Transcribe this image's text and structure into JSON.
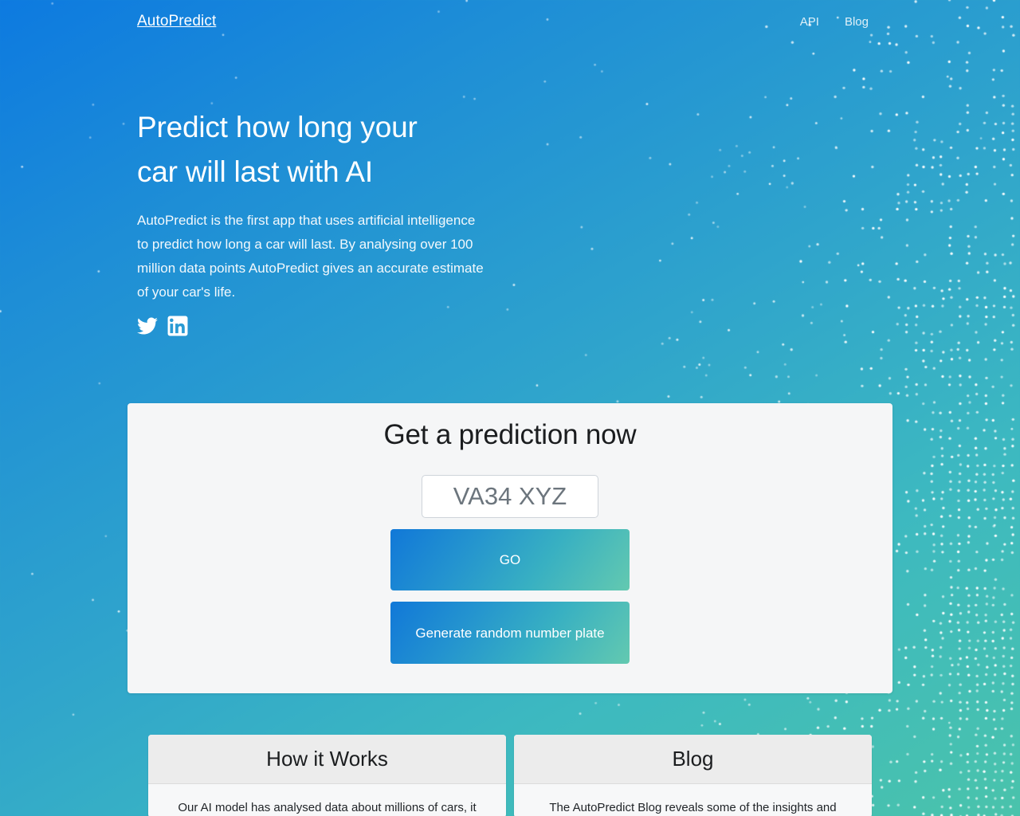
{
  "navbar": {
    "brand": "AutoPredict",
    "links": [
      {
        "label": "API"
      },
      {
        "label": "Blog"
      }
    ]
  },
  "hero": {
    "title_line1": "Predict how long your",
    "title_line2": "car will last with AI",
    "subtitle": "AutoPredict is the first app that uses artificial intelligence to predict how long a car will last. By analysing over 100 million data points AutoPredict gives an accurate estimate of your car's life.",
    "socials": [
      {
        "name": "twitter-icon",
        "label": "Twitter"
      },
      {
        "name": "linkedin-icon",
        "label": "LinkedIn"
      }
    ]
  },
  "prediction": {
    "title": "Get a prediction now",
    "plate_placeholder": "VA34 XYZ",
    "plate_value": "",
    "go_label": "GO",
    "random_label": "Generate random number plate"
  },
  "info_cards": [
    {
      "heading": "How it Works",
      "body": "Our AI model has analysed data about millions of cars, it"
    },
    {
      "heading": "Blog",
      "body": "The AutoPredict Blog reveals some of the insights and"
    }
  ],
  "colors": {
    "gradient_start": "#0d7ae0",
    "gradient_end": "#4ac3ab",
    "card_bg": "#f5f6f7",
    "button_start": "#1178d8",
    "button_end": "#63c9b0",
    "text_light": "#ffffff"
  }
}
